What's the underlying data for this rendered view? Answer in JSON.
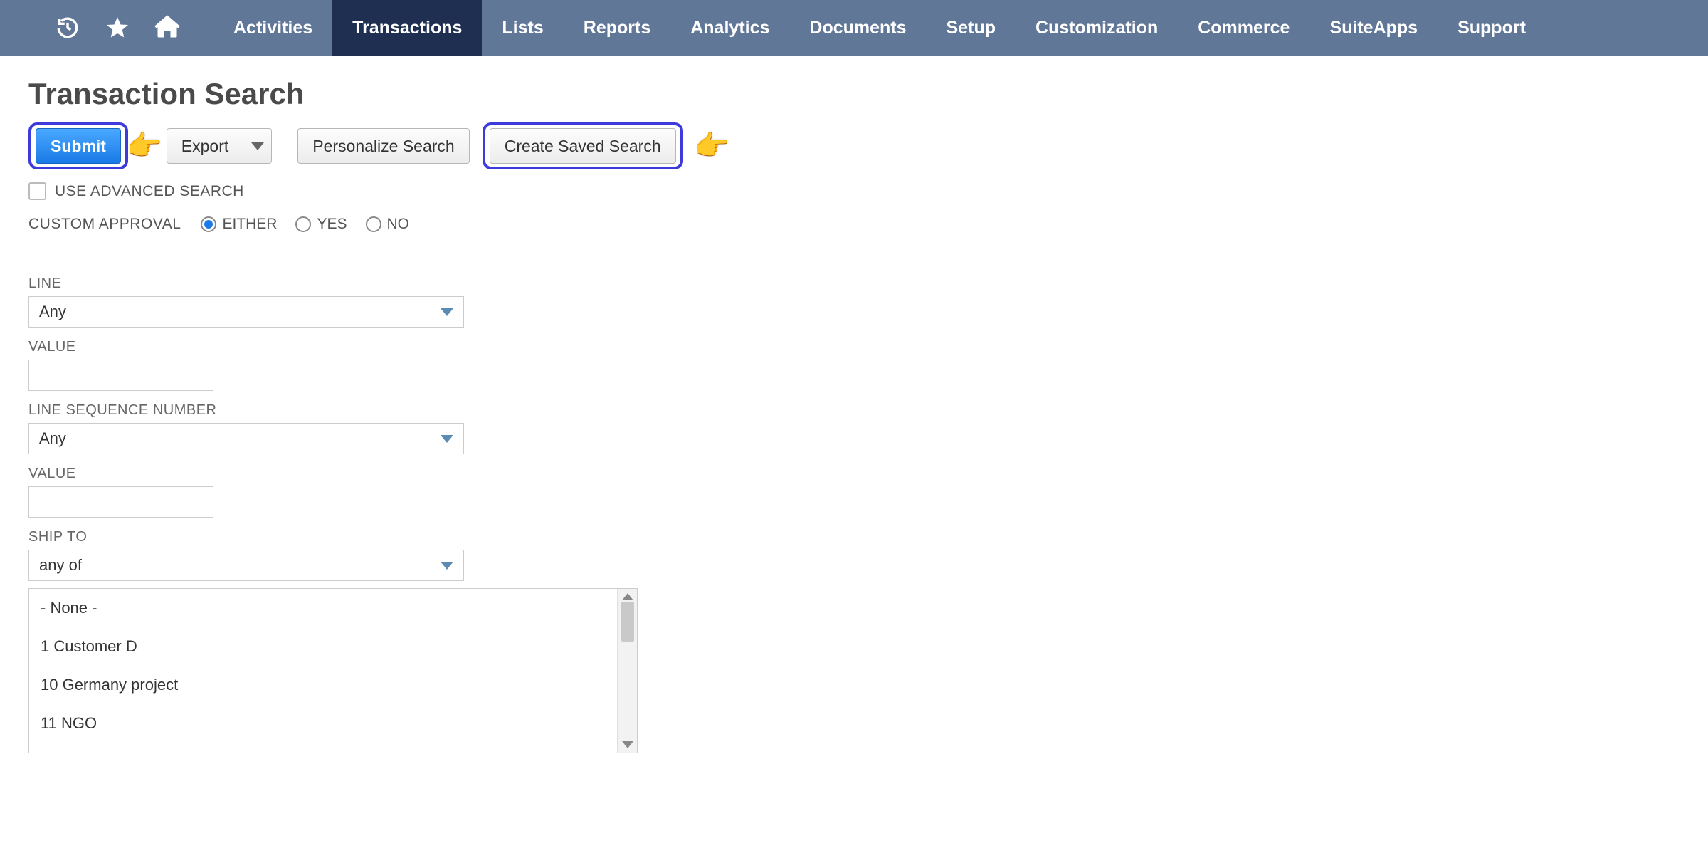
{
  "nav": {
    "items": [
      "Activities",
      "Transactions",
      "Lists",
      "Reports",
      "Analytics",
      "Documents",
      "Setup",
      "Customization",
      "Commerce",
      "SuiteApps",
      "Support"
    ],
    "active_index": 1
  },
  "page": {
    "title": "Transaction Search"
  },
  "buttons": {
    "submit": "Submit",
    "export": "Export",
    "personalize": "Personalize Search",
    "create_saved": "Create Saved Search"
  },
  "advanced": {
    "use_advanced_label": "USE ADVANCED SEARCH",
    "use_advanced_checked": false
  },
  "custom_approval": {
    "label": "CUSTOM APPROVAL",
    "options": [
      "EITHER",
      "YES",
      "NO"
    ],
    "selected_index": 0
  },
  "fields": {
    "line": {
      "label": "LINE",
      "value": "Any"
    },
    "value1": {
      "label": "VALUE",
      "value": ""
    },
    "line_seq": {
      "label": "LINE SEQUENCE NUMBER",
      "value": "Any"
    },
    "value2": {
      "label": "VALUE",
      "value": ""
    },
    "ship_to": {
      "label": "SHIP TO",
      "operator": "any of",
      "options": [
        "- None -",
        "1 Customer D",
        "10 Germany project",
        "11 NGO"
      ]
    }
  }
}
